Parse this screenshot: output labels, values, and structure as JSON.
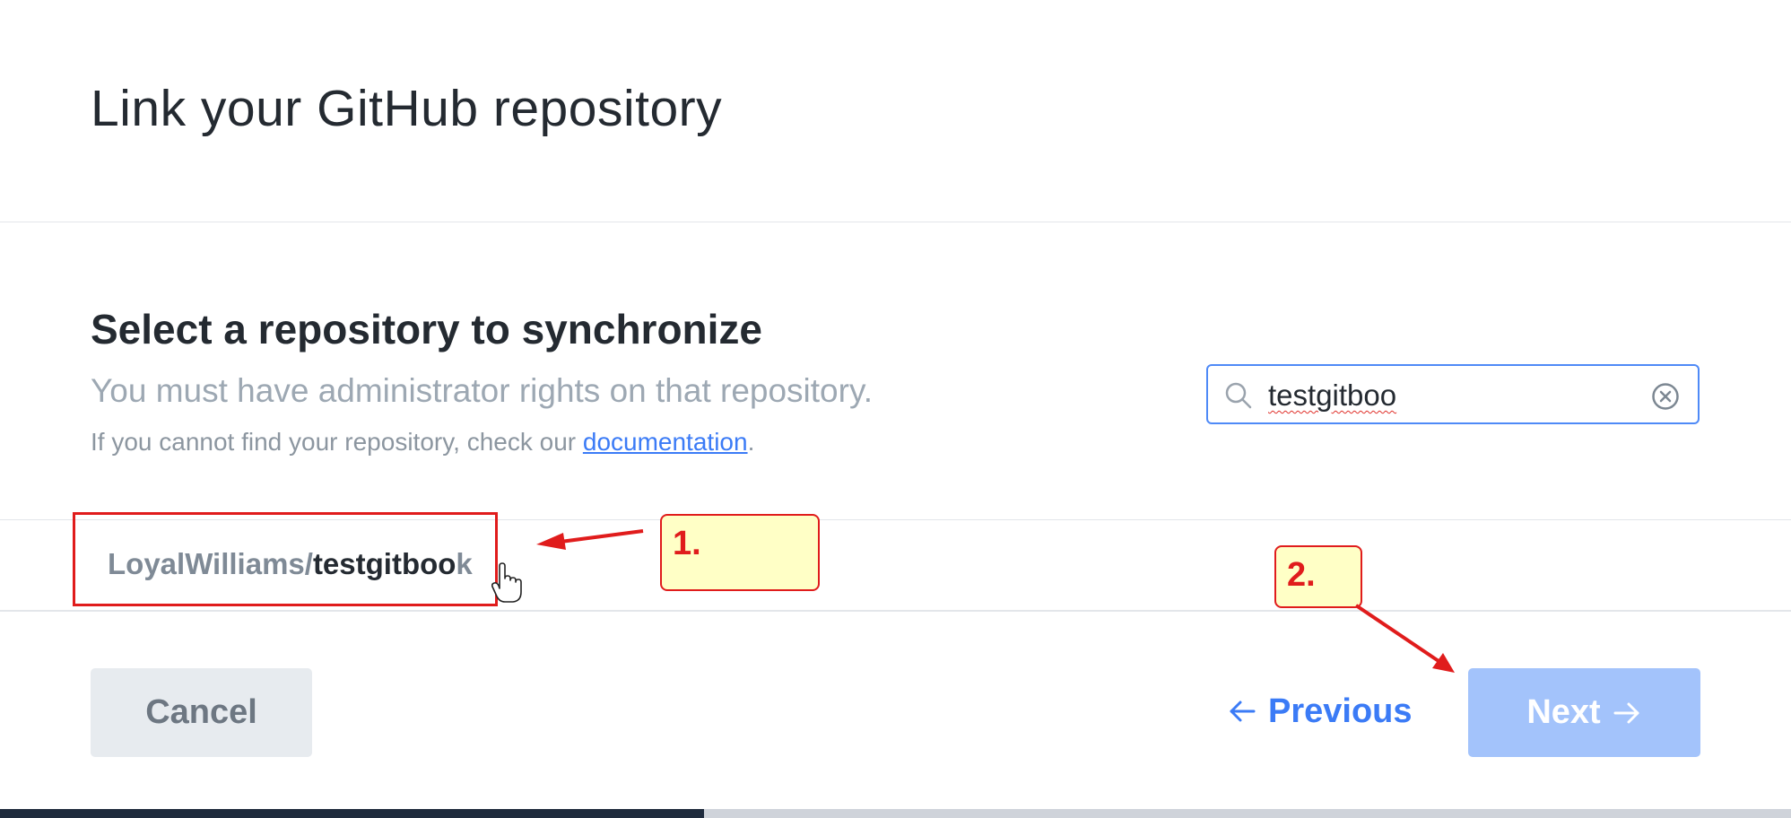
{
  "modal": {
    "title": "Link your GitHub repository",
    "section_title": "Select a repository to synchronize",
    "subtitle": "You must have administrator rights on that repository.",
    "help_prefix": "If you cannot find your repository, check our ",
    "help_link": "documentation",
    "help_suffix": "."
  },
  "search": {
    "value": "testgitboo",
    "icon": "search-icon",
    "clear_icon": "clear-circle-icon"
  },
  "repo_result": {
    "owner_prefix": "LoyalWilliams/",
    "match": "testgitboo",
    "rest": "k"
  },
  "annotations": {
    "step1": "1.",
    "step2": "2."
  },
  "footer": {
    "cancel_label": "Cancel",
    "previous_label": "Previous",
    "previous_icon": "arrow-left-icon",
    "next_label": "Next",
    "next_icon": "arrow-right-icon"
  },
  "colors": {
    "accent": "#3b7bf6",
    "next_disabled": "#a3c3fb",
    "annotation_red": "#e01c1c",
    "annotation_fill": "#ffffc6"
  }
}
